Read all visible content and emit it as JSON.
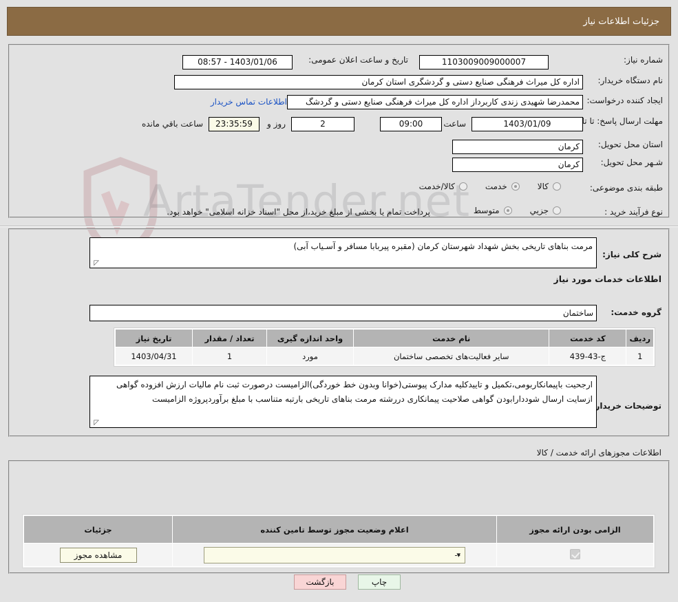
{
  "header": {
    "title": "جزئیات اطلاعات نیاز"
  },
  "form": {
    "need_number_label": "شماره نیاز:",
    "need_number_value": "1103009009000007",
    "announce_datetime_label": "تاریخ و ساعت اعلان عمومی:",
    "announce_datetime_value": "1403/01/06 - 08:57",
    "buyer_org_label": "نام دستگاه خریدار:",
    "buyer_org_value": "اداره کل میراث فرهنگی  صنایع دستی و گردشگری استان کرمان",
    "requester_label": "ایجاد کننده درخواست:",
    "requester_value": "محمدرضا شهیدی زندی کاربرداز اداره کل میراث فرهنگی  صنایع دستی و گردشگ",
    "buyer_contact_link": "اطلاعات تماس خریدار",
    "deadline_label": "مهلت ارسال پاسخ: تا تاریخ:",
    "deadline_date": "1403/01/09",
    "deadline_hour_label": "ساعت",
    "deadline_hour": "09:00",
    "days_remaining": "2",
    "days_word": "روز و",
    "time_remaining": "23:35:59",
    "time_remaining_suffix": "ساعت باقي مانده",
    "province_label": "استان محل تحویل:",
    "province_value": "کرمان",
    "city_label": "شـهر محل تحویل:",
    "city_value": "کرمان",
    "category_label": "طبقه بندی موضوعی:",
    "category_options": [
      {
        "label": "کالا",
        "selected": false
      },
      {
        "label": "خدمت",
        "selected": true
      },
      {
        "label": "کالا/خدمت",
        "selected": false
      }
    ],
    "process_label": "نوع فرآیند خرید :",
    "process_options": [
      {
        "label": "جزیي",
        "selected": false
      },
      {
        "label": "متوسط",
        "selected": true
      }
    ],
    "process_note": "پرداخت تمام یا بخشی از مبلغ خرید،از محل \"اسناد خزانه اسلامی\" خواهد بود."
  },
  "description": {
    "label": "شرح کلی نیاز:",
    "value": "مرمت بناهای تاریخی بخش شهداد شهرستان کرمان (مقبره پیربابا مسافر و آسـیاب آبی)"
  },
  "services_section": {
    "caption": "اطلاعات خدمات مورد نیاز",
    "group_label": "گروه خدمت:",
    "group_value": "ساختمان"
  },
  "services_table": {
    "columns": [
      "ردیف",
      "کد خدمت",
      "نام خدمت",
      "واحد اندازه گیری",
      "تعداد / مقدار",
      "تاریخ نیاز"
    ],
    "rows": [
      {
        "row_no": "1",
        "service_code": "ج-43-439",
        "service_name": "سایر فعالیت‌های تخصصی ساختمان",
        "unit": "مورد",
        "quantity": "1",
        "need_date": "1403/04/31"
      }
    ]
  },
  "buyer_notes": {
    "label": "توضیحات خریدار:",
    "value": "ارجحیت باپیمانکاربومی،تکمیل و تاییدکلیه مدارک پیوستی(خوانا وبدون خط خوردگی)الزامیست درصورت ثبت نام مالیات ارزش افزوده گواهی ازسایت ارسال شودداراﺑودن گواهی صلاحیت پیمانکاری دررشته مرمت بناهای تاریخی بارتبه متناسب با مبلغ برآوردپروژه الزامیست"
  },
  "licenses_section": {
    "caption": "اطلاعات مجوزهای ارائه خدمت / کالا",
    "columns": [
      "الزامی بودن ارائه مجوز",
      "اعلام وضعیت مجوز توسط تامین کننده",
      "جزئیات"
    ],
    "rows": [
      {
        "required": true,
        "status_value": "--",
        "details_button": "مشاهده مجوز"
      }
    ]
  },
  "footer": {
    "print_label": "چاپ",
    "back_label": "بازگشت"
  },
  "watermark": {
    "text": "ArtaTender.net"
  },
  "colors": {
    "header_bg": "#8b6b44",
    "page_bg": "#e2e2e2",
    "link": "#1b53c4",
    "table_header": "#b4b4b4",
    "print_btn": "#e8f6e8",
    "back_btn": "#f9d5d5",
    "cream_field": "#fbfbe8"
  }
}
